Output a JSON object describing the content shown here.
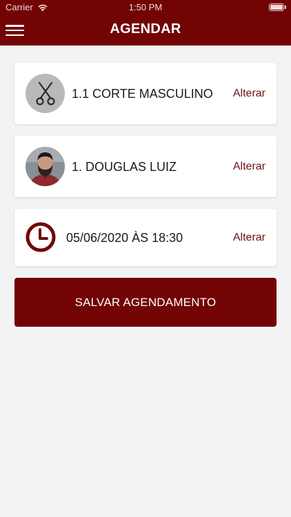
{
  "status_bar": {
    "carrier": "Carrier",
    "time": "1:50 PM"
  },
  "header": {
    "title": "AGENDAR"
  },
  "service_card": {
    "label": "1.1 CORTE MASCULINO",
    "action": "Alterar",
    "icon": "scissors-icon"
  },
  "professional_card": {
    "label": "1. DOUGLAS LUIZ",
    "action": "Alterar"
  },
  "datetime_card": {
    "label": "05/06/2020 ÀS 18:30",
    "action": "Alterar",
    "icon": "clock-icon"
  },
  "save_button": {
    "label": "SALVAR AGENDAMENTO"
  },
  "colors": {
    "brand": "#720404",
    "background": "#f3f3f3",
    "card": "#ffffff",
    "link": "#6e1010"
  }
}
